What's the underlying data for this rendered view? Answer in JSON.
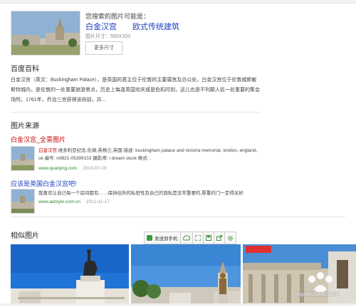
{
  "query": {
    "guess_label": "您搜索的图片可能是：",
    "guesses": [
      "白金汉宫",
      "欧式传统建筑"
    ],
    "size_text": "图片尺寸：500X333",
    "more_sizes_label": "更多尺寸"
  },
  "baike": {
    "title": "百度百科",
    "text": "白金汉宫（英文：Buckingham Palace），是英国的君主位于伦敦的主要寝宫及办公处。白金汉宫位于伦敦威斯敏斯特城内，是伦敦的一处重要旅游景点，历史上每逢英国欢庆或是危机时刻，这儿也是不列颠人民一处重要的集会场所。1761年，乔治三世获得该府邸，并..."
  },
  "sources": {
    "title": "图片来源",
    "items": [
      {
        "title": "白金汉宫_全景图片",
        "highlight": "白金汉宫",
        "desc": ",维多利亚纪念,伦敦,英格兰,英国 描述: buckingham palace and victoria memorial, london, england, uk 编号: mf821-05399153 摄影师: i dream stock 格式: .",
        "url": "www.quanjing.com",
        "date": "2013-07-19"
      },
      {
        "title": "应该是英国白金汉宫吧!",
        "highlight": "",
        "desc": "我喜欢让自己每一个房间都有……保持住所的私密性及自己的隐私是非常重要的,厚重的门一定得关好.",
        "url": "www.adstyle.com.cn",
        "date": "2012-11-17"
      }
    ]
  },
  "similar": {
    "title": "相似图片",
    "toolbar": {
      "send_label": "发送到手机"
    }
  },
  "watermark": "jingyan.baidu.com",
  "colors": {
    "link_blue": "#1f3fbf",
    "highlight_red": "#cc0000",
    "url_green": "#2b8a2b"
  }
}
